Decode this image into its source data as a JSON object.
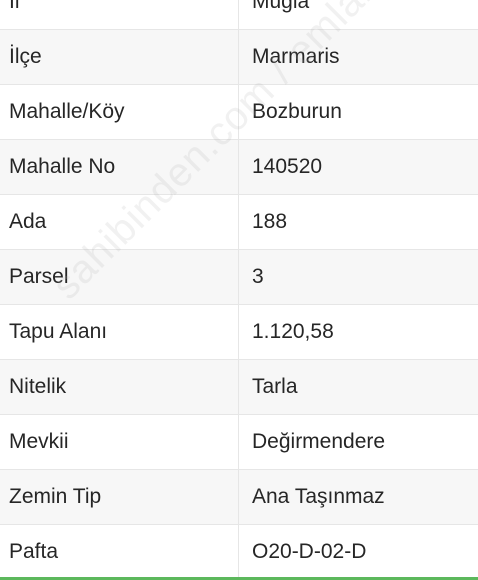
{
  "rows": [
    {
      "label": "İl",
      "value": "Muğla"
    },
    {
      "label": "İlçe",
      "value": "Marmaris"
    },
    {
      "label": "Mahalle/Köy",
      "value": "Bozburun"
    },
    {
      "label": "Mahalle No",
      "value": "140520"
    },
    {
      "label": "Ada",
      "value": "188"
    },
    {
      "label": "Parsel",
      "value": "3"
    },
    {
      "label": "Tapu Alanı",
      "value": "1.120,58"
    },
    {
      "label": "Nitelik",
      "value": "Tarla"
    },
    {
      "label": "Mevkii",
      "value": "Değirmendere"
    },
    {
      "label": "Zemin Tip",
      "value": "Ana Taşınmaz"
    },
    {
      "label": "Pafta",
      "value": "O20-D-02-D"
    }
  ],
  "watermark": "sahibinden.com / emlakjet.com",
  "colors": {
    "row_shaded": "#f7f7f7",
    "divider": "#e6e6e6",
    "text": "#262626",
    "accent_bar": "#5cb85c"
  }
}
